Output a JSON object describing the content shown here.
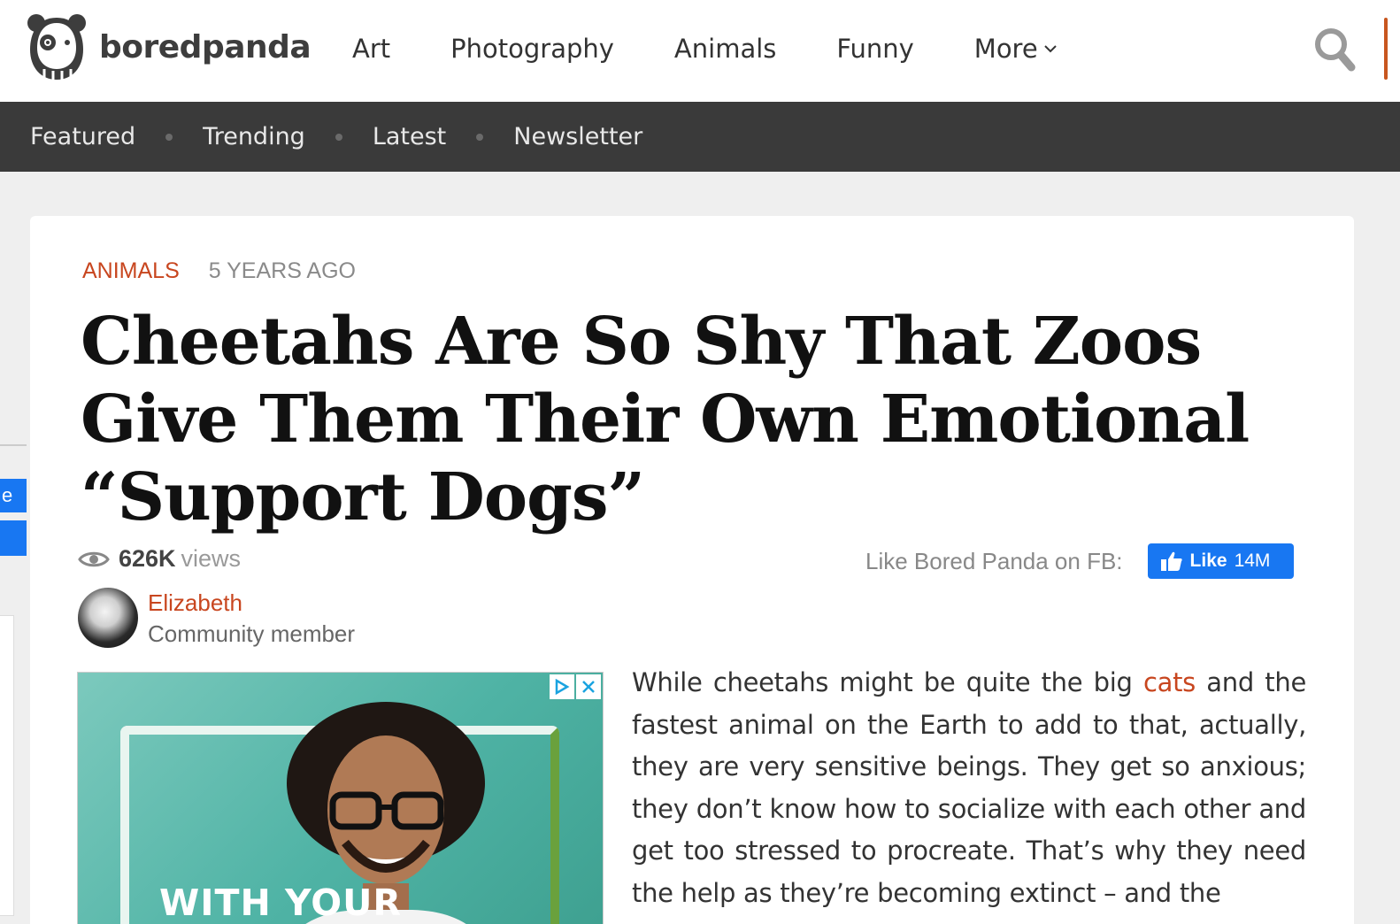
{
  "header": {
    "logo_text": "boredpanda",
    "nav": [
      "Art",
      "Photography",
      "Animals",
      "Funny",
      "More"
    ]
  },
  "subnav": [
    "Featured",
    "Trending",
    "Latest",
    "Newsletter"
  ],
  "article": {
    "category": "ANIMALS",
    "posted": "5 YEARS AGO",
    "title": "Cheetahs Are So Shy That Zoos Give Them Their Own Emotional “Support Dogs”",
    "views_count": "626K",
    "views_label": "views",
    "fb_label": "Like Bored Panda on FB:",
    "fb_button": "Like",
    "fb_count": "14M",
    "author_name": "Elizabeth",
    "author_role": "Community member",
    "ad_text": "WITH YOUR",
    "body_before_link": "While cheetahs might be quite the big ",
    "body_link": "cats",
    "body_after_link": " and the fastest animal on the Earth to add to that, actually, they are very sensitive beings. They get so anxious; they don’t know how to socialize with each other and get too stressed to procreate. That’s why they need the help as they’re becoming extinct – and the"
  },
  "left_tab_fragment": "e",
  "colors": {
    "accent": "#c8461f",
    "subnav_bg": "#3a3a3a",
    "facebook": "#1877f2"
  }
}
